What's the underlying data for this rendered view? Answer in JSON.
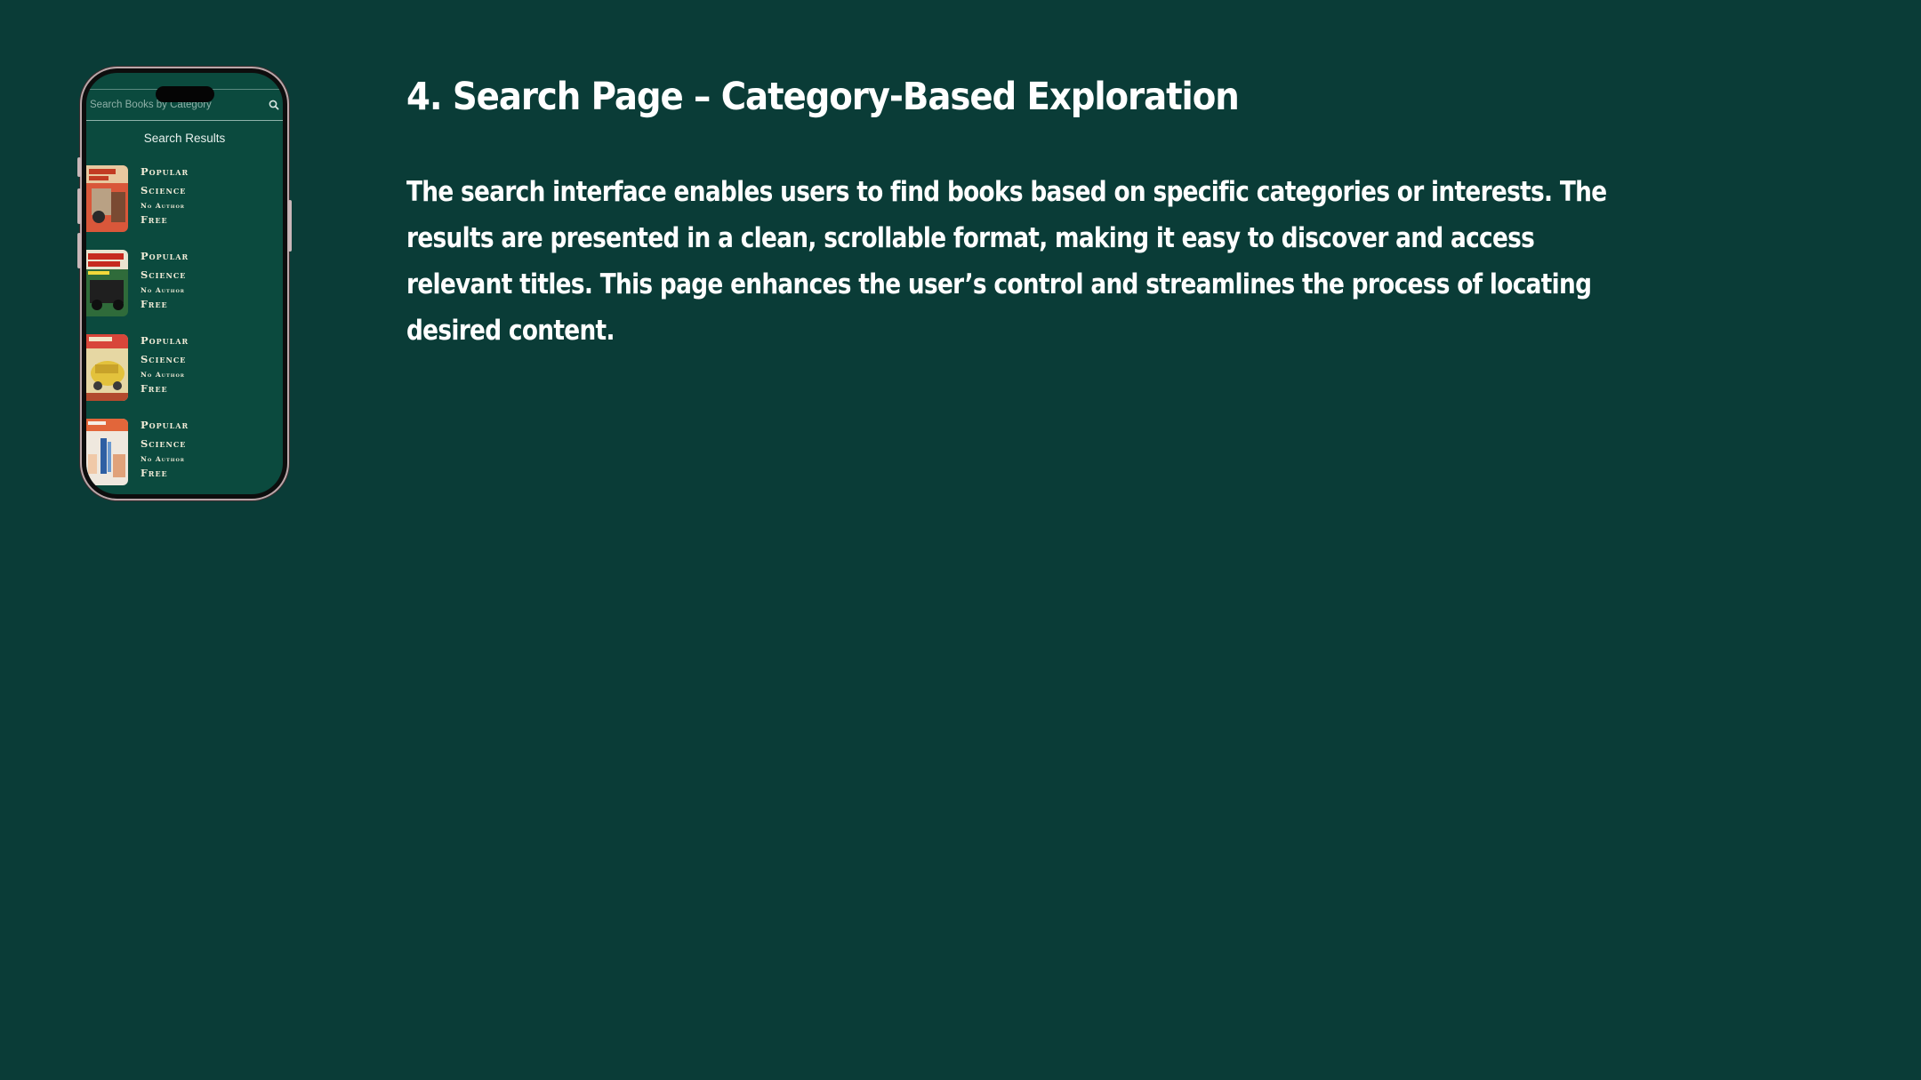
{
  "slide": {
    "heading": "4. Search Page – Category-Based Exploration",
    "description": "The search interface enables users to find books based on specific categories or interests. The results are presented in a clean, scrollable format, making it easy to discover and access relevant titles. This page enhances the user’s control and streamlines the process of locating desired content."
  },
  "phone": {
    "search": {
      "placeholder": "Search Books by Category",
      "icon": "search-icon"
    },
    "results_title": "Search Results",
    "results": [
      {
        "title": "Popular Science",
        "author": "No Author",
        "price": "Free"
      },
      {
        "title": "Popular Science",
        "author": "No Author",
        "price": "Free"
      },
      {
        "title": "Popular Science",
        "author": "No Author",
        "price": "Free"
      },
      {
        "title": "Popular Science",
        "author": "No Author",
        "price": "Free"
      }
    ]
  },
  "colors": {
    "background": "#0a3c37",
    "screen": "#0b4a3e",
    "text": "#ffffff",
    "result_text": "#f2ecd8"
  }
}
